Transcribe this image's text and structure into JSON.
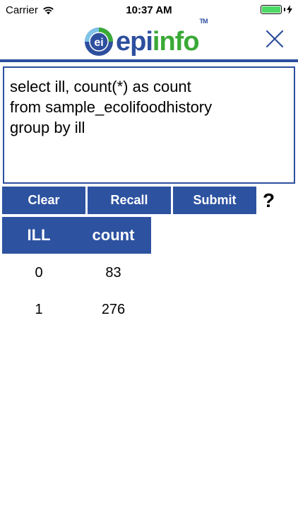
{
  "status_bar": {
    "carrier": "Carrier",
    "time": "10:37 AM",
    "wifi_icon": "wifi-icon",
    "battery_icon": "battery-icon",
    "charging_icon": "charging-bolt-icon",
    "battery_level": 1.0
  },
  "header": {
    "logo_mark": "ei",
    "logo_epi": "epi",
    "logo_info": "info",
    "logo_tm": "TM",
    "close_icon": "close-icon"
  },
  "query": {
    "text": "select ill, count(*) as count\nfrom sample_ecolifoodhistory\ngroup by ill"
  },
  "buttons": {
    "clear": "Clear",
    "recall": "Recall",
    "submit": "Submit",
    "help": "?"
  },
  "results": {
    "columns": [
      "ILL",
      "count"
    ],
    "rows": [
      [
        "0",
        "83"
      ],
      [
        "1",
        "276"
      ]
    ]
  },
  "colors": {
    "brand_blue": "#2d52a0",
    "brand_green": "#39a935",
    "battery_green": "#4cd964"
  }
}
